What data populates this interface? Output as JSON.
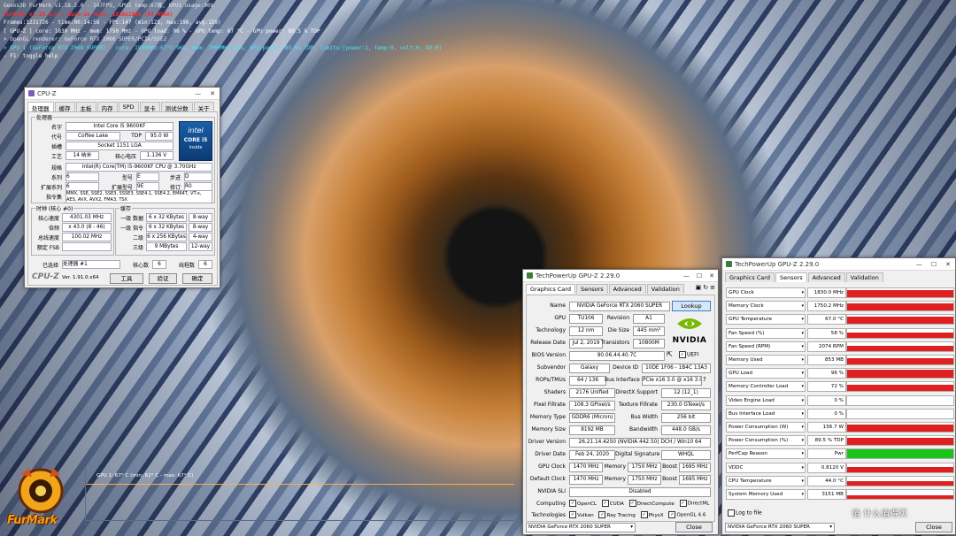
{
  "osd": {
    "line0": "Geeks3D FurMark v1.18.2.0 - 147FPS, GPU1 temp:67度, GPU1 usage:96%",
    "line1": "FurMark v1.18.2.0 - Burn-in test, 1920x1080 (8X MSAA)",
    "line2": "Frames:1231726 - time:00:14:58 - FPS:147 (min:125, max:196, avg:159)",
    "line3": "[ GPU-Z ] core: 1830 MHz - mem: 1750 MHz - GPU load: 96 % - GPU temp: 67 °C - GPU power: 89.5 % TDP",
    "line4": "> OpenGL renderer: GeForce RTX 2060 SUPER/PCIe/SSE2",
    "line5": "> GPU 1 (GeForce RTX 2060 SUPER) - core: 1830MHz:67°C:96%, mem: 7000MHz:41%, GPU power: 89.5% TDP, limits:[power:1, temp:0, volt:0, OV:0]",
    "line6": "- F1: toggle help",
    "graph_label": "GPU 1: 67° C (min: 62° C - max: 67° C)",
    "logo_text": "FurMark"
  },
  "cpuz": {
    "title": "CPU-Z",
    "tabs": [
      "处理器",
      "缓存",
      "主板",
      "内存",
      "SPD",
      "显卡",
      "测试分数",
      "关于"
    ],
    "group_processor": "处理器",
    "labels": {
      "name": "名字",
      "code": "代号",
      "package": "插槽",
      "tech": "工艺",
      "spec": "规格",
      "family": "系列",
      "ext_family": "扩展系列",
      "instr": "指令集",
      "tdp": "TDP",
      "voltage": "核心电压",
      "model": "型号",
      "ext_model": "扩展型号",
      "stepping": "步进",
      "revision": "修订"
    },
    "values": {
      "name": "Intel Core i5 9600KF",
      "code": "Coffee Lake",
      "tdp": "95.0 W",
      "package": "Socket 1151 LGA",
      "tech": "14 纳米",
      "voltage": "1.136 V",
      "spec": "Intel(R) Core(TM) i5-9600KF CPU @ 3.70GHz",
      "family": "6",
      "model": "E",
      "stepping": "D",
      "ext_family": "6",
      "ext_model": "9E",
      "revision": "R0",
      "instr": "MMX, SSE, SSE2, SSE3, SSSE3, SSE4.1, SSE4.2, EM64T, VT-x, AES, AVX, AVX2, FMA3, TSX"
    },
    "intel_badge": {
      "brand": "intel",
      "core": "CORE i5",
      "gen": "inside"
    },
    "group_clock": "时钟 (核心 #0)",
    "clock_labels": {
      "core_speed": "核心速度",
      "multiplier": "倍频",
      "bus_speed": "总线速度",
      "rated_fsb": "额定 FSB"
    },
    "clock_values": {
      "core_speed": "4301.03 MHz",
      "multiplier": "x 43.0 (8 - 46)",
      "bus_speed": "100.02 MHz",
      "rated_fsb": ""
    },
    "group_cache": "缓存",
    "cache_labels": {
      "l1d": "一级 数据",
      "l1i": "一级 指令",
      "l2": "二级",
      "l3": "三级"
    },
    "cache_values": {
      "l1d": "6 x 32 KBytes",
      "l1d_way": "8-way",
      "l1i": "6 x 32 KBytes",
      "l1i_way": "8-way",
      "l2": "6 x 256 KBytes",
      "l2_way": "4-way",
      "l3": "9 MBytes",
      "l3_way": "12-way"
    },
    "selected_label": "已选择",
    "selected_value": "处理器 #1",
    "cores_label": "核心数",
    "cores_value": "6",
    "threads_label": "线程数",
    "threads_value": "6",
    "logo": "CPU-Z",
    "version": "Ver. 1.91.0.x64",
    "tools_btn": "工具",
    "validate_btn": "验证",
    "close_btn": "确定"
  },
  "gpuz1": {
    "title": "TechPowerUp GPU-Z 2.29.0",
    "tabs": [
      "Graphics Card",
      "Sensors",
      "Advanced",
      "Validation"
    ],
    "lookup_btn": "Lookup",
    "vendor_logo": "NVIDIA",
    "labels": {
      "name": "Name",
      "gpu": "GPU",
      "revision": "Revision",
      "technology": "Technology",
      "die_size": "Die Size",
      "release_date": "Release Date",
      "transistors": "Transistors",
      "bios": "BIOS Version",
      "uefi": "UEFI",
      "subvendor": "Subvendor",
      "device_id": "Device ID",
      "rops": "ROPs/TMUs",
      "bus_interface": "Bus Interface",
      "shaders": "Shaders",
      "directx": "DirectX Support",
      "pixel_fillrate": "Pixel Fillrate",
      "texture_fillrate": "Texture Fillrate",
      "memory_type": "Memory Type",
      "bus_width": "Bus Width",
      "memory_size": "Memory Size",
      "bandwidth": "Bandwidth",
      "driver_version": "Driver Version",
      "driver_date": "Driver Date",
      "digital_signature": "Digital Signature",
      "gpu_clock": "GPU Clock",
      "memory": "Memory",
      "boost": "Boost",
      "default_clock": "Default Clock",
      "sli": "NVIDIA SLI",
      "computing": "Computing",
      "technologies": "Technologies"
    },
    "values": {
      "name": "NVIDIA GeForce RTX 2060 SUPER",
      "gpu": "TU106",
      "revision": "A1",
      "technology": "12 nm",
      "die_size": "445 mm²",
      "release_date": "Jul 2, 2019",
      "transistors": "10800M",
      "bios": "90.06.44.40.7C",
      "subvendor": "Galaxy",
      "device_id": "10DE 1F06 - 1B4C 13A3",
      "rops": "64 / 136",
      "bus_interface": "PCIe x16 3.0 @ x16 3.0",
      "shaders": "2176 Unified",
      "directx": "12 (12_1)",
      "pixel_fillrate": "108.3 GPixel/s",
      "texture_fillrate": "230.0 GTexel/s",
      "memory_type": "GDDR6 (Micron)",
      "bus_width": "256 bit",
      "memory_size": "8192 MB",
      "bandwidth": "448.0 GB/s",
      "driver_version": "26.21.14.4250 (NVIDIA 442.50) DCH / Win10 64",
      "driver_date": "Feb 24, 2020",
      "digital_signature": "WHQL",
      "gpu_clock": "1470 MHz",
      "gpu_mem": "1750 MHz",
      "gpu_boost": "1695 MHz",
      "default_clock": "1470 MHz",
      "default_mem": "1750 MHz",
      "default_boost": "1695 MHz",
      "sli": "Disabled"
    },
    "computing": [
      "OpenCL",
      "CUDA",
      "DirectCompute",
      "DirectML"
    ],
    "technologies": [
      "Vulkan",
      "Ray Tracing",
      "PhysX",
      "OpenGL 4.6"
    ],
    "selected_card": "NVIDIA GeForce RTX 2060 SUPER",
    "close_btn": "Close"
  },
  "gpuz2": {
    "title": "TechPowerUp GPU-Z 2.29.0",
    "tabs": [
      "Graphics Card",
      "Sensors",
      "Advanced",
      "Validation"
    ],
    "sensors": [
      {
        "name": "GPU Clock",
        "value": "1830.0 MHz",
        "fill": 0.85,
        "color": "#e02020"
      },
      {
        "name": "Memory Clock",
        "value": "1750.2 MHz",
        "fill": 0.85,
        "color": "#e02020"
      },
      {
        "name": "GPU Temperature",
        "value": "67.0 °C",
        "fill": 0.8,
        "color": "#e02020"
      },
      {
        "name": "Fan Speed (%)",
        "value": "58 %",
        "fill": 0.6,
        "color": "#e02020"
      },
      {
        "name": "Fan Speed (RPM)",
        "value": "2074 RPM",
        "fill": 0.6,
        "color": "#e02020"
      },
      {
        "name": "Memory Used",
        "value": "853 MB",
        "fill": 0.7,
        "color": "#e02020"
      },
      {
        "name": "GPU Load",
        "value": "96 %",
        "fill": 0.9,
        "color": "#e02020"
      },
      {
        "name": "Memory Controller Load",
        "value": "72 %",
        "fill": 0.7,
        "color": "#e02020"
      },
      {
        "name": "Video Engine Load",
        "value": "0 %",
        "fill": 0,
        "color": "#e02020"
      },
      {
        "name": "Bus Interface Load",
        "value": "0 %",
        "fill": 0,
        "color": "#e02020"
      },
      {
        "name": "Power Consumption (W)",
        "value": "156.7 W",
        "fill": 0.85,
        "color": "#e02020"
      },
      {
        "name": "Power Consumption (%)",
        "value": "89.5 % TDP",
        "fill": 0.85,
        "color": "#e02020"
      },
      {
        "name": "PerfCap Reason",
        "value": "Pwr",
        "fill": 1,
        "color": "#1bc41b"
      },
      {
        "name": "VDDC",
        "value": "0.8120 V",
        "fill": 0.55,
        "color": "#e02020"
      },
      {
        "name": "CPU Temperature",
        "value": "44.0 °C",
        "fill": 0.5,
        "color": "#e02020"
      },
      {
        "name": "System Memory Used",
        "value": "3151 MB",
        "fill": 0.45,
        "color": "#e02020"
      }
    ],
    "log_label": "Log to file",
    "selected_card": "NVIDIA GeForce RTX 2060 SUPER",
    "close_btn": "Close"
  },
  "watermark": "值 什么值得买"
}
